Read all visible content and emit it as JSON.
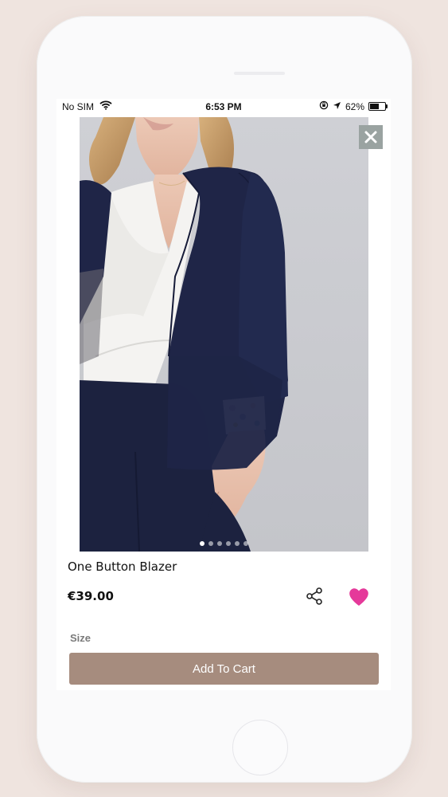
{
  "status_bar": {
    "carrier": "No SIM",
    "time": "6:53 PM",
    "battery": "62%",
    "battery_level": 0.62
  },
  "product": {
    "title": "One Button Blazer",
    "price": "€39.00",
    "size_label": "Size",
    "add_to_cart_label": "Add To Cart",
    "image_count": 6,
    "active_image_index": 0
  },
  "icons": {
    "close": "close-icon",
    "share": "share-icon",
    "favorite": "heart-icon",
    "wifi": "wifi-icon",
    "location": "location-arrow-icon",
    "lock_rotation": "orientation-lock-icon"
  },
  "colors": {
    "background": "#efe4df",
    "accent_button": "#a68c7e",
    "favorite": "#e5399a",
    "close_button_bg": "#9aa3a1",
    "jacket": "#1f2547"
  }
}
